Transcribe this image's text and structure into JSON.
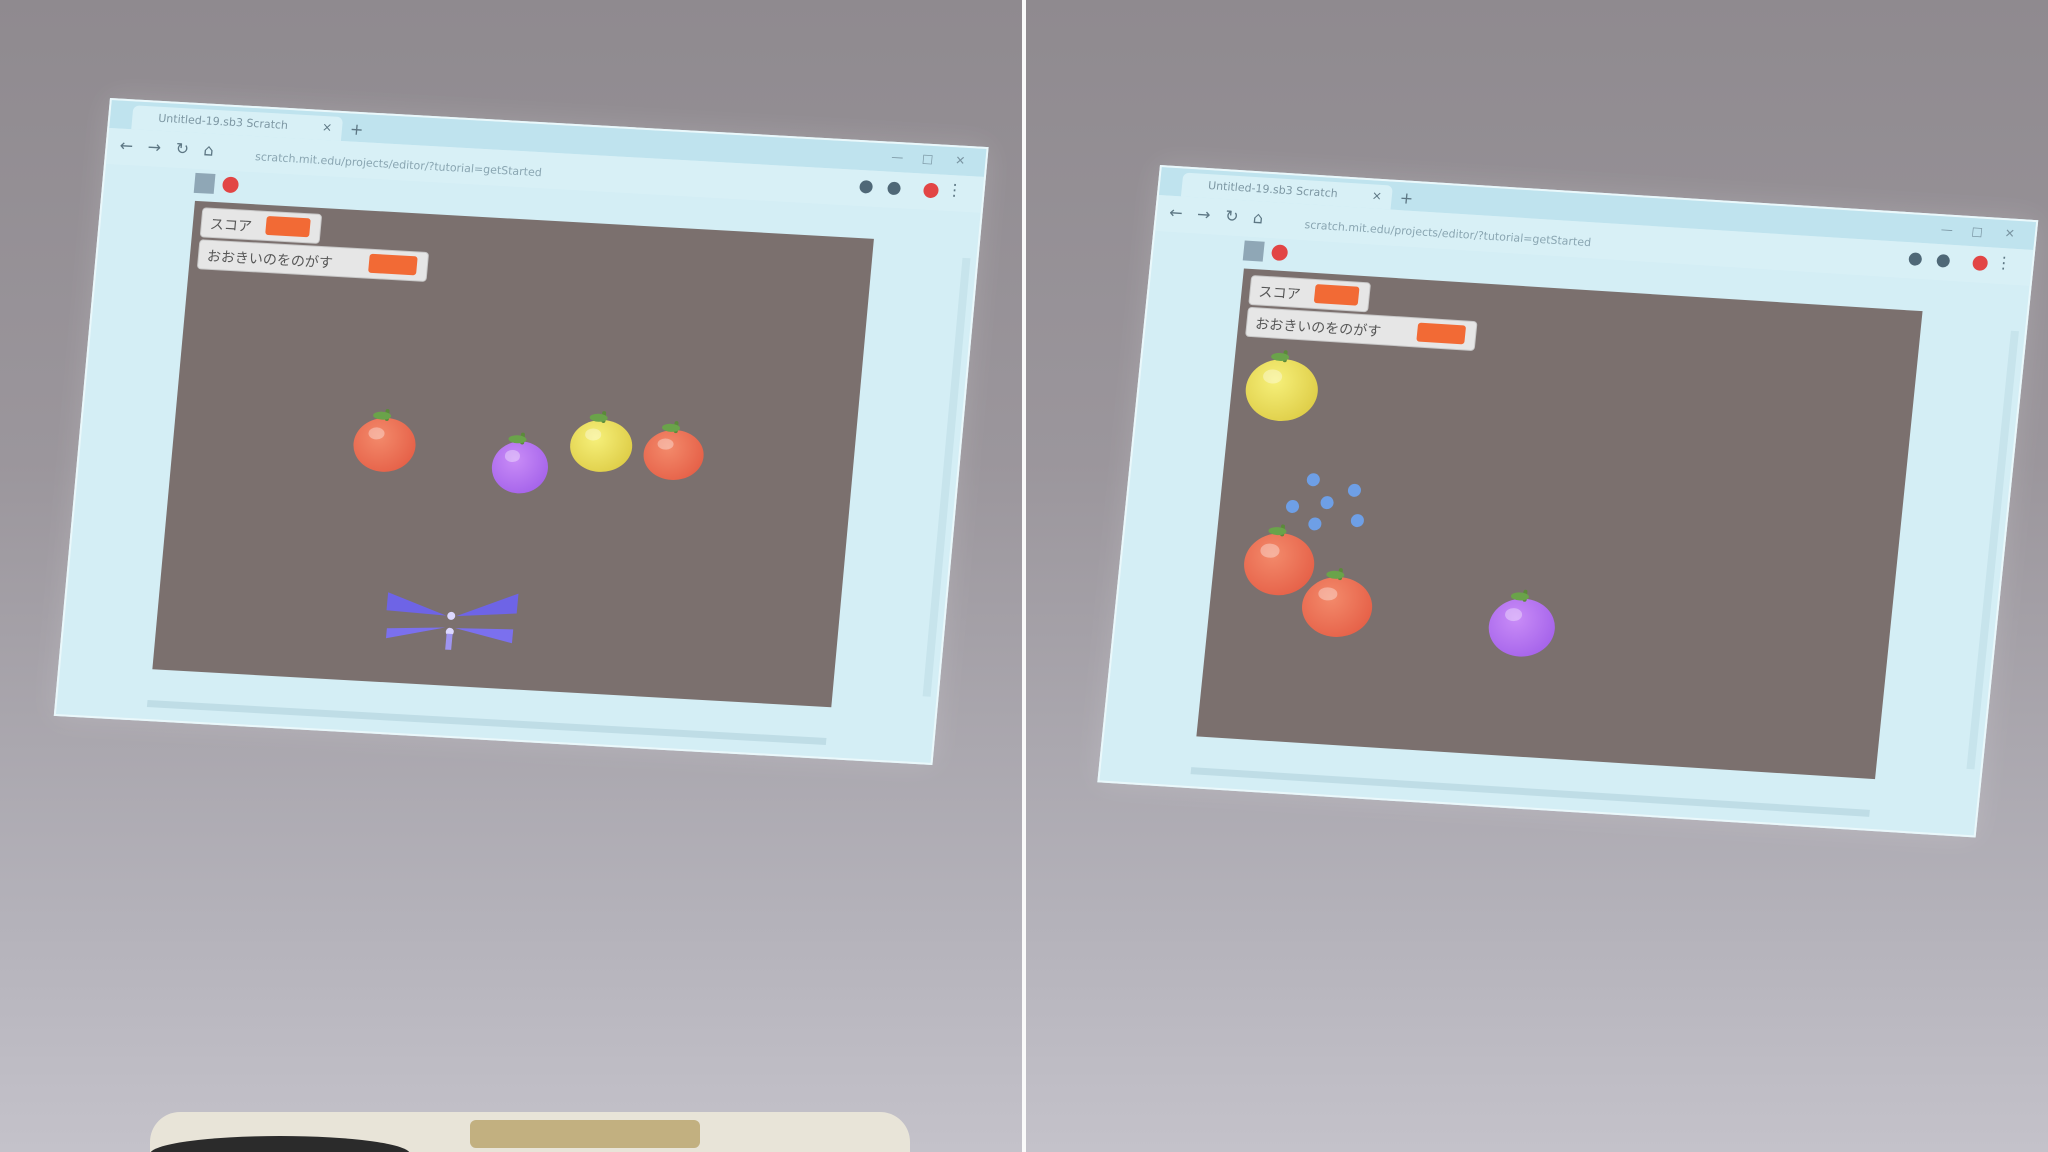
{
  "browser": {
    "tab_title": "Untitled-19.sb3 Scratch",
    "tab_close": "×",
    "new_tab": "+",
    "url": "scratch.mit.edu/projects/editor/?tutorial=getStarted",
    "window_controls": [
      "—",
      "□",
      "✕"
    ],
    "nav": [
      "←",
      "→",
      "↻",
      "⌂"
    ],
    "menu": "⋮"
  },
  "monitors": {
    "score_label": "スコア",
    "fruit_label": "おおきいのをのがす"
  },
  "stage": {
    "fullscreen": "⛶"
  },
  "colors": {
    "stage_bg": "#7b706e",
    "tomato": "#e2553e",
    "yellow_fruit": "#d8c43a",
    "purple_fruit": "#9b58e7",
    "monitor_value": "#f26a35",
    "blue_dots": "#6e9fe6"
  },
  "icons": {
    "flag": "green-flag-icon",
    "stop": "stop-icon",
    "fullscreen": "fullscreen-icon"
  }
}
